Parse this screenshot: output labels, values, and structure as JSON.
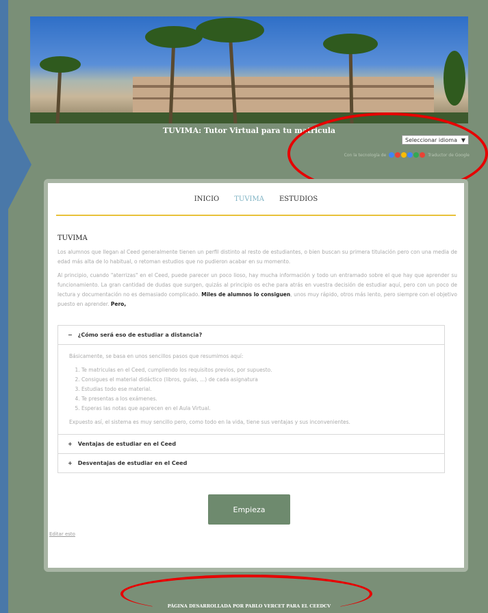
{
  "header": {
    "site_title": "TUVIMA: Tutor Virtual para tu matricula",
    "translate_select": "Seleccionar idioma",
    "translate_credit_left": "Con la tecnología de",
    "translate_credit_right": "Traductor de Google"
  },
  "nav": {
    "items": [
      "INICIO",
      "TUVIMA",
      "ESTUDIOS"
    ]
  },
  "content": {
    "section_title": "TUVIMA",
    "para1": "Los alumnos que llegan al Ceed generalmente tienen un perfil distinto al resto de estudiantes, o bien buscan su primera titulación pero con una media de edad más alta de lo habitual, o retoman estudios que no pudieron acabar en su momento.",
    "para2_start": "Al principio, cuando \"aterrizas\" en el Ceed, puede parecer un poco lioso, hay mucha información y todo un entramado sobre el que hay que aprender su funcionamiento. La gran cantidad de dudas que surgen, quizás al principio os eche para atrás en vuestra decisión de estudiar aquí, pero con un poco de lectura y documentación no es demasiado complicado.",
    "para2_bold1": "Miles de alumnos lo consiguen",
    "para2_mid": ", unos muy rápido, otros más lento, pero siempre con el objetivo puesto en aprender.",
    "para2_bold2": "Pero,"
  },
  "accordion": {
    "open_title": "¿Cómo será eso de estudiar a distancia?",
    "open_symbol": "−",
    "intro": "Básicamente, se basa en unos sencillos pasos que resumimos aquí:",
    "steps": [
      "Te matriculas en el Ceed, cumpliendo los requisitos previos, por supuesto.",
      "Consigues el material didáctico (libros, guías, ...) de cada asignatura",
      "Estudias todo ese material.",
      "Te presentas a los exámenes.",
      "Esperas las notas que aparecen en el Aula Virtual."
    ],
    "outro": "Expuesto así, el sistema es muy sencillo pero, como todo en la vida, tiene sus ventajas y sus inconvenientes.",
    "closed_symbol": "+",
    "closed_items": [
      "Ventajas de estudiar en el Ceed",
      "Desventajas de estudiar en el Ceed"
    ]
  },
  "actions": {
    "start_button": "Empieza",
    "edit_link": "Editar esto"
  },
  "footer": {
    "text": "PÁGINA DESARROLLADA POR PABLO VERCET PARA EL CEEDCV"
  },
  "colors": {
    "page_bg": "#7a8f77",
    "accent_rule": "#e8c23a",
    "active_nav": "#7fb3c4",
    "button": "#6e8a6e",
    "annotation": "#e60000",
    "arrow": "#4a78a8"
  }
}
